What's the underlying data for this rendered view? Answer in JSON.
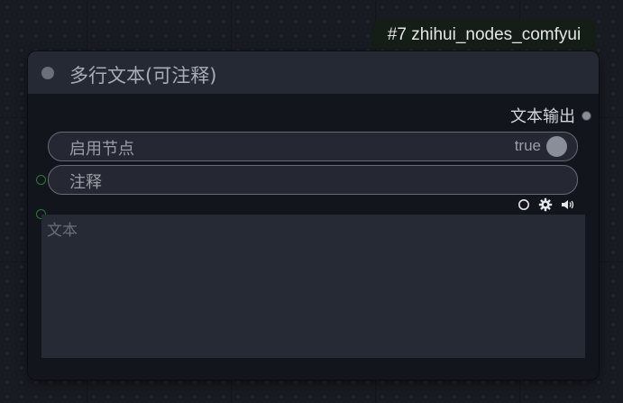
{
  "badge": {
    "label": "#7 zhihui_nodes_comfyui"
  },
  "node": {
    "title": "多行文本(可注释)",
    "output": {
      "label": "文本输出"
    },
    "widgets": {
      "enable": {
        "label": "启用节点",
        "value": "true"
      },
      "comment": {
        "label": "注释"
      }
    },
    "textarea": {
      "placeholder": "文本",
      "value": ""
    },
    "icons": [
      "circle-icon",
      "gear-icon",
      "speaker-icon"
    ]
  },
  "colors": {
    "canvas": "#181b22",
    "node_body": "#12151c",
    "node_header": "#252933",
    "widget_bg": "#252833",
    "widget_border": "#666b75",
    "badge_bg": "#141e16",
    "slot_green": "#2e7a38"
  }
}
